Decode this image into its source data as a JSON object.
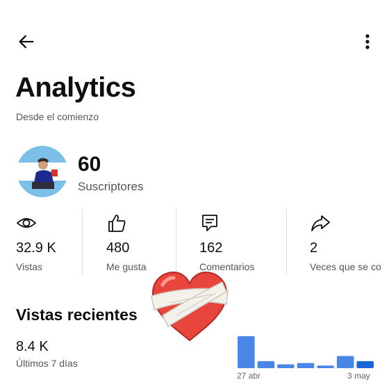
{
  "header": {
    "back_icon": "arrow-left-icon",
    "more_icon": "more-vert-icon"
  },
  "page": {
    "title": "Analytics",
    "subtitle": "Desde el comienzo"
  },
  "channel": {
    "subscriber_count": "60",
    "subscriber_label": "Suscriptores"
  },
  "stats": [
    {
      "icon": "eye-icon",
      "value": "32.9 K",
      "label": "Vistas"
    },
    {
      "icon": "thumbs-up-icon",
      "value": "480",
      "label": "Me gusta"
    },
    {
      "icon": "comment-icon",
      "value": "162",
      "label": "Comentarios"
    },
    {
      "icon": "share-icon",
      "value": "2",
      "label": "Veces que se co"
    }
  ],
  "recent": {
    "title": "Vistas recientes",
    "value": "8.4 K",
    "label": "Últimos 7 días"
  },
  "chart_data": {
    "type": "bar",
    "categories": [
      "27 abr",
      "",
      "",
      "",
      "",
      "",
      "3 may"
    ],
    "values": [
      100,
      22,
      12,
      16,
      8,
      38,
      22
    ],
    "x_tick_labels": [
      "27 abr",
      "3 may"
    ],
    "colors": [
      "#4a86e8",
      "#4a86e8",
      "#4a86e8",
      "#4a86e8",
      "#4a86e8",
      "#4a86e8",
      "#1a66d6"
    ]
  },
  "overlay": {
    "sticker": "mended-heart-sticker"
  }
}
